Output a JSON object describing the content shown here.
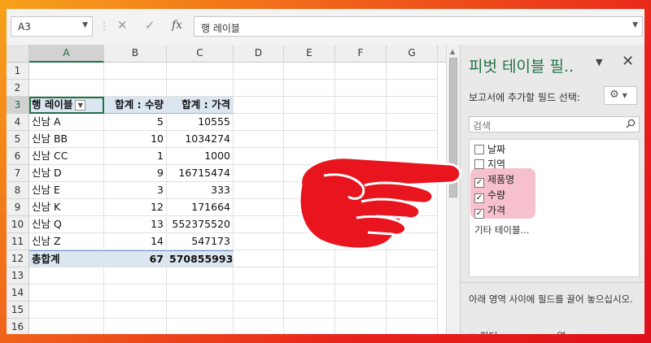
{
  "formula_bar": {
    "name_box": "A3",
    "cancel_icon": "✕",
    "enter_icon": "✓",
    "fx_label": "fx",
    "formula": "행 레이블"
  },
  "sheet": {
    "columns": [
      "A",
      "B",
      "C",
      "D",
      "E",
      "F",
      "G"
    ],
    "rows": [
      "1",
      "2",
      "3",
      "4",
      "5",
      "6",
      "7",
      "8",
      "9",
      "10",
      "11",
      "12",
      "13",
      "14",
      "15",
      "16"
    ],
    "pivot_header": {
      "label": "행 레이블",
      "qty": "합계 : 수량",
      "price": "합계 : 가격"
    },
    "pivot_rows": [
      {
        "label": "신남 A",
        "qty": "5",
        "price": "10555"
      },
      {
        "label": "신남 BB",
        "qty": "10",
        "price": "1034274"
      },
      {
        "label": "신남 CC",
        "qty": "1",
        "price": "1000"
      },
      {
        "label": "신남 D",
        "qty": "9",
        "price": "16715474"
      },
      {
        "label": "신남 E",
        "qty": "3",
        "price": "333"
      },
      {
        "label": "신남 K",
        "qty": "12",
        "price": "171664"
      },
      {
        "label": "신남 Q",
        "qty": "13",
        "price": "552375520"
      },
      {
        "label": "신남 Z",
        "qty": "14",
        "price": "547173"
      }
    ],
    "pivot_total": {
      "label": "총합계",
      "qty": "67",
      "price": "570855993"
    }
  },
  "pivot_pane": {
    "title": "피벗 테이블 필..",
    "subtitle": "보고서에 추가할 필드 선택:",
    "search_placeholder": "검색",
    "fields": [
      {
        "label": "날짜",
        "checked": false
      },
      {
        "label": "지역",
        "checked": false
      },
      {
        "label": "제품명",
        "checked": true
      },
      {
        "label": "수량",
        "checked": true
      },
      {
        "label": "가격",
        "checked": true
      }
    ],
    "more_tables": "기타 테이블...",
    "instruction": "아래 영역 사이에 필드를 끌어 놓으십시오.",
    "area_filter": "필터",
    "area_columns": "열"
  },
  "colors": {
    "excel_green": "#217346",
    "pivot_header_fill": "#dce6f1",
    "hand_fill": "#e8141e",
    "highlight": "#f6b9c8"
  }
}
